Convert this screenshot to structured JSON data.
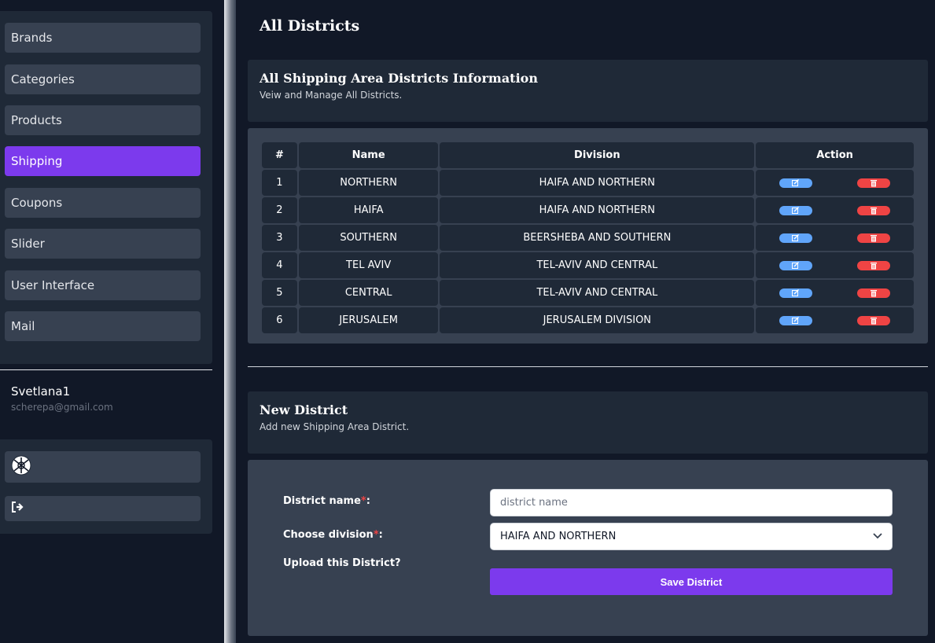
{
  "sidebar": {
    "items": [
      {
        "label": "Brands",
        "active": false
      },
      {
        "label": "Categories",
        "active": false
      },
      {
        "label": "Products",
        "active": false
      },
      {
        "label": "Shipping",
        "active": true
      },
      {
        "label": "Coupons",
        "active": false
      },
      {
        "label": "Slider",
        "active": false
      },
      {
        "label": "User Interface",
        "active": false
      },
      {
        "label": "Mail",
        "active": false
      }
    ],
    "user": {
      "name": "Svetlana1",
      "email": "scherepa@gmail.com"
    },
    "utility_icons": [
      "avatar-icon",
      "logout-icon"
    ]
  },
  "page": {
    "title": "All Districts"
  },
  "districts_card": {
    "title": "All Shipping Area Districts Information",
    "subtitle": "Veiw and Manage All Districts."
  },
  "table": {
    "headers": [
      "#",
      "Name",
      "Division",
      "Action"
    ],
    "rows": [
      {
        "num": "1",
        "name": "NORTHERN",
        "division": "HAIFA AND NORTHERN"
      },
      {
        "num": "2",
        "name": "HAIFA",
        "division": "HAIFA AND NORTHERN"
      },
      {
        "num": "3",
        "name": "SOUTHERN",
        "division": "BEERSHEBA AND SOUTHERN"
      },
      {
        "num": "4",
        "name": "TEL AVIV",
        "division": "TEL-AVIV AND CENTRAL"
      },
      {
        "num": "5",
        "name": "CENTRAL",
        "division": "TEL-AVIV AND CENTRAL"
      },
      {
        "num": "6",
        "name": "JERUSALEM",
        "division": "JERUSALEM DIVISION"
      }
    ],
    "action_icons": [
      "edit-icon",
      "trash-icon"
    ]
  },
  "new_district": {
    "title": "New District",
    "subtitle": "Add new Shipping Area District.",
    "name_label": "District name",
    "name_placeholder": "district name",
    "name_value": "",
    "division_label": "Choose division",
    "division_value": "HAIFA AND NORTHERN",
    "required_mark": "*",
    "label_suffix": ":",
    "upload_label": "Upload this District?",
    "save_label": "Save District"
  },
  "colors": {
    "background": "#111827",
    "panel": "#1f2937",
    "item": "#374151",
    "accent": "#7c3aed",
    "edit": "#60a5fa",
    "delete": "#ef4444"
  }
}
